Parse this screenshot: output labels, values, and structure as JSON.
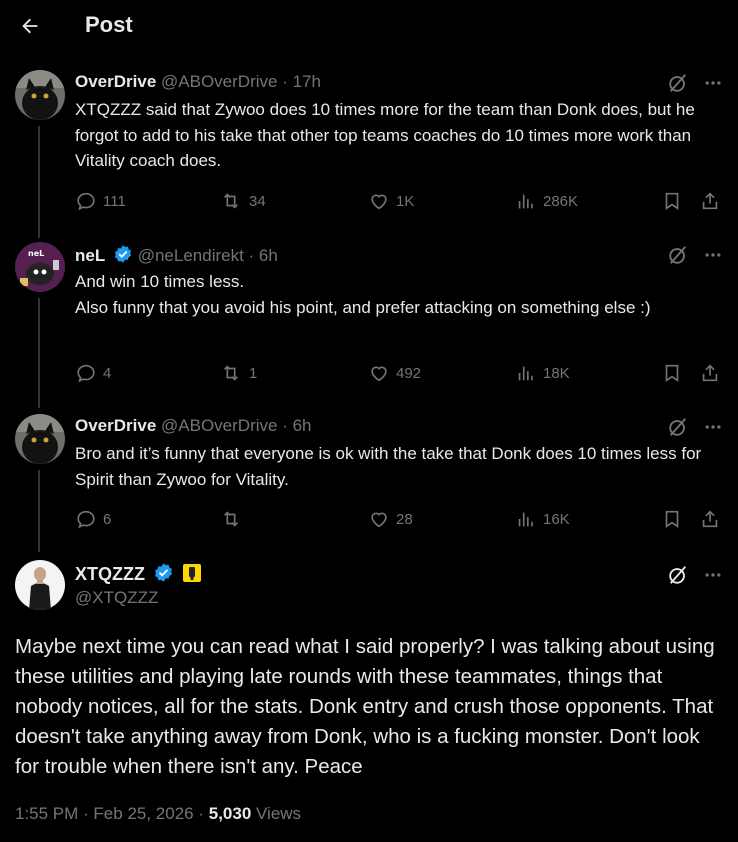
{
  "header": {
    "title": "Post"
  },
  "replies": [
    {
      "name": "OverDrive",
      "handle": "@ABOverDrive",
      "time": "17h",
      "text": "XTQZZZ said that Zywoo does 10 times more for the team than Donk does, but he forgot to add to his take that other top teams coaches do 10 times more work than Vitality coach does.",
      "replies": "111",
      "reposts": "34",
      "likes": "1K",
      "views": "286K"
    },
    {
      "name": "neL",
      "handle": "@neLendirekt",
      "time": "6h",
      "text": "And win 10 times less.\nAlso funny that you avoid his point, and prefer attacking on something else :)",
      "replies": "4",
      "reposts": "1",
      "likes": "492",
      "views": "18K"
    },
    {
      "name": "OverDrive",
      "handle": "@ABOverDrive",
      "time": "6h",
      "text": "Bro and it’s funny that everyone is ok with the take that Donk does 10 times less for Spirit than Zywoo for Vitality.",
      "replies": "6",
      "reposts": "",
      "likes": "28",
      "views": "16K"
    }
  ],
  "main": {
    "name": "XTQZZZ",
    "handle": "@XTQZZZ",
    "text": "Maybe next time you can read what I said properly? I was talking about using these utilities and playing late rounds with these teammates, things that nobody notices, all for the stats. Donk entry and crush those opponents. That doesn't take anything away from Donk, who is a fucking monster. Don't look for trouble when there isn't any. Peace",
    "time": "1:55 PM",
    "date": "Feb 25, 2026",
    "views_count": "5,030",
    "views_label": "Views"
  },
  "icons": {
    "back": "arrow-left-icon",
    "grok": "grok-icon",
    "more": "more-icon",
    "reply": "reply-icon",
    "repost": "repost-icon",
    "like": "like-icon",
    "views": "views-icon",
    "bookmark": "bookmark-icon",
    "share": "share-icon",
    "verified": "verified-badge-icon",
    "affiliate": "affiliate-badge-icon"
  },
  "colors": {
    "background": "#000000",
    "text": "#e7e9ea",
    "muted": "#71767b",
    "verified": "#1d9bf0",
    "affiliate": "#ffd400"
  }
}
